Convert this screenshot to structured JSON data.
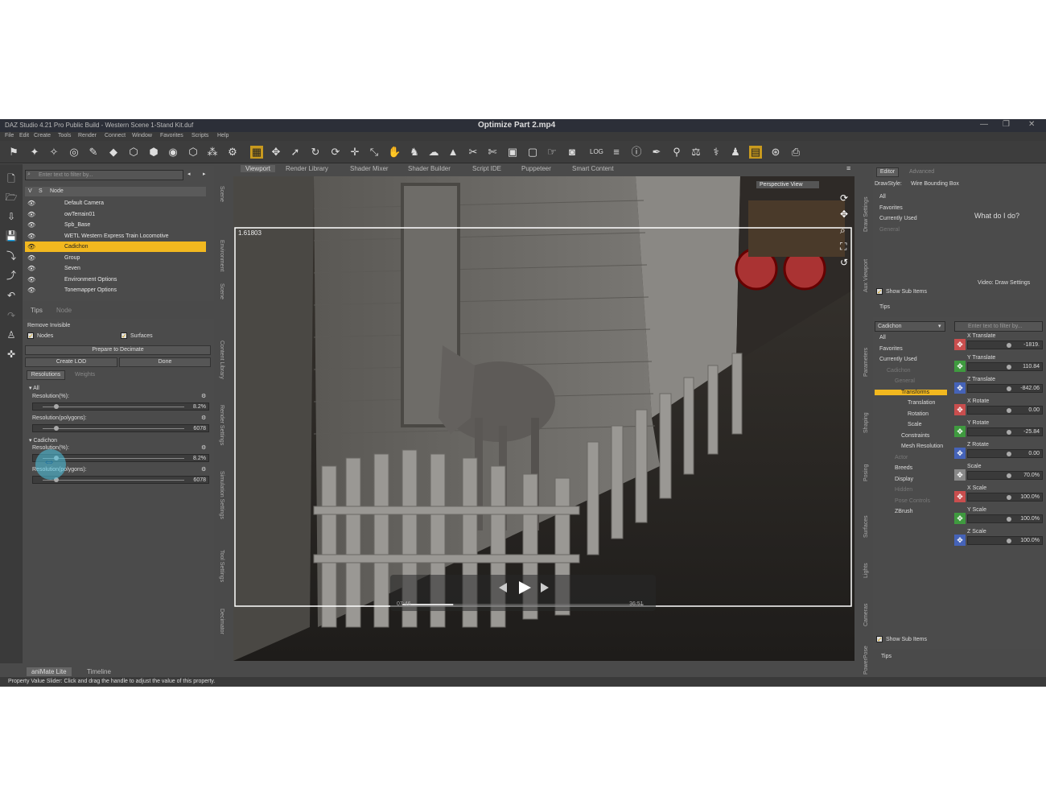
{
  "title": {
    "app": "DAZ Studio 4.21 Pro Public Build - Western Scene 1-Stand Kit.duf",
    "video": "Optimize Part 2.mp4",
    "controls": [
      "—",
      "❐",
      "✕"
    ]
  },
  "menu": [
    "File",
    "Edit",
    "Create",
    "Tools",
    "Render",
    "Connect",
    "Window",
    "Favorites",
    "Scripts",
    "Help"
  ],
  "toolbar": {
    "log_label": "LOG"
  },
  "scene": {
    "search_placeholder": "Enter text to filter by...",
    "header": {
      "v": "V",
      "s": "S",
      "node": "Node"
    },
    "nodes": [
      "Default Camera",
      "owTerrain01",
      "Spb_Base",
      "WETL Western Express Train Locomotive",
      "Cadichon",
      "Group",
      "Seven",
      "Environment Options",
      "Tonemapper Options"
    ],
    "tabs": [
      "Tips",
      "Node"
    ]
  },
  "decimator": {
    "remove_invisible": "Remove Invisible",
    "nodes_label": "Nodes",
    "surfaces_label": "Surfaces",
    "prepare_button": "Prepare to Decimate",
    "create_lod_button": "Create LOD",
    "done_button": "Done",
    "tabs": [
      "Resolutions",
      "Weights"
    ],
    "groups": [
      {
        "name": "All",
        "res_pct_label": "Resolution(%):",
        "res_pct": "8.2%",
        "res_pct_fraction": 0.082,
        "res_poly_label": "Resolution(polygons):",
        "res_poly": "6078",
        "res_poly_fraction": 0.082
      },
      {
        "name": "Cadichon",
        "res_pct_label": "Resolution(%):",
        "res_pct": "8.2%",
        "res_pct_fraction": 0.082,
        "res_poly_label": "Resolution(polygons):",
        "res_poly": "6078",
        "res_poly_fraction": 0.082
      }
    ]
  },
  "left_side_tabs": [
    "Scene",
    "Environment",
    "Scene",
    "Content Library",
    "Render Settings",
    "Simulation Settings",
    "Tool Settings",
    "Decimator"
  ],
  "viewport": {
    "tabs": [
      "Viewport",
      "Render Library",
      "Shader Mixer",
      "Shader Builder",
      "Script IDE",
      "Puppeteer",
      "Smart Content"
    ],
    "aspect_label": "1.61803",
    "view_label": "Perspective View",
    "video_time_current": "07:46",
    "video_time_total": "36:51",
    "video_progress": 0.211
  },
  "draw_settings": {
    "tabs": [
      "Editor",
      "Advanced"
    ],
    "drawstyle_label": "DrawStyle:",
    "drawstyle_value": "Wire Bounding Box",
    "list": [
      "All",
      "Favorites",
      "Currently Used",
      "General"
    ],
    "what_do_label": "What do I do?",
    "show_sub_items": "Show Sub Items",
    "video_link": "Video: Draw Settings",
    "tips_tab": "Tips"
  },
  "parameters": {
    "node_select": "Cadichon",
    "search_placeholder": "Enter text to filter by...",
    "tree": [
      "All",
      "Favorites",
      "Currently Used",
      "Cadichon",
      "General",
      "Transforms",
      "Translation",
      "Rotation",
      "Scale",
      "Constraints",
      "Mesh Resolution",
      "Actor",
      "Breeds",
      "Display",
      "Hidden",
      "Pose Controls",
      "ZBrush"
    ],
    "props": [
      {
        "name": "X Translate",
        "value": "-1819.",
        "color": "#c94e4e"
      },
      {
        "name": "Y Translate",
        "value": "110.84",
        "color": "#3f9a3f"
      },
      {
        "name": "Z Translate",
        "value": "-842.06",
        "color": "#4563b8"
      },
      {
        "name": "X Rotate",
        "value": "0.00",
        "color": "#c94e4e"
      },
      {
        "name": "Y Rotate",
        "value": "-25.84",
        "color": "#3f9a3f"
      },
      {
        "name": "Z Rotate",
        "value": "0.00",
        "color": "#4563b8"
      },
      {
        "name": "Scale",
        "value": "70.0%",
        "color": "#888888"
      },
      {
        "name": "X Scale",
        "value": "100.0%",
        "color": "#c94e4e"
      },
      {
        "name": "Y Scale",
        "value": "100.0%",
        "color": "#3f9a3f"
      },
      {
        "name": "Z Scale",
        "value": "100.0%",
        "color": "#4563b8"
      }
    ],
    "show_sub_items": "Show Sub Items",
    "tips_tab": "Tips"
  },
  "right_side_tabs": [
    "Draw Settings",
    "Aux Viewport",
    "Parameters",
    "Shaping",
    "Posing",
    "Surfaces",
    "Lights",
    "Cameras",
    "PowerPose"
  ],
  "bottom_tabs": [
    "aniMate Lite",
    "Timeline"
  ],
  "status_text": "Property Value Slider: Click and drag the handle to adjust the value of this property.",
  "accent": "#f2b81f"
}
